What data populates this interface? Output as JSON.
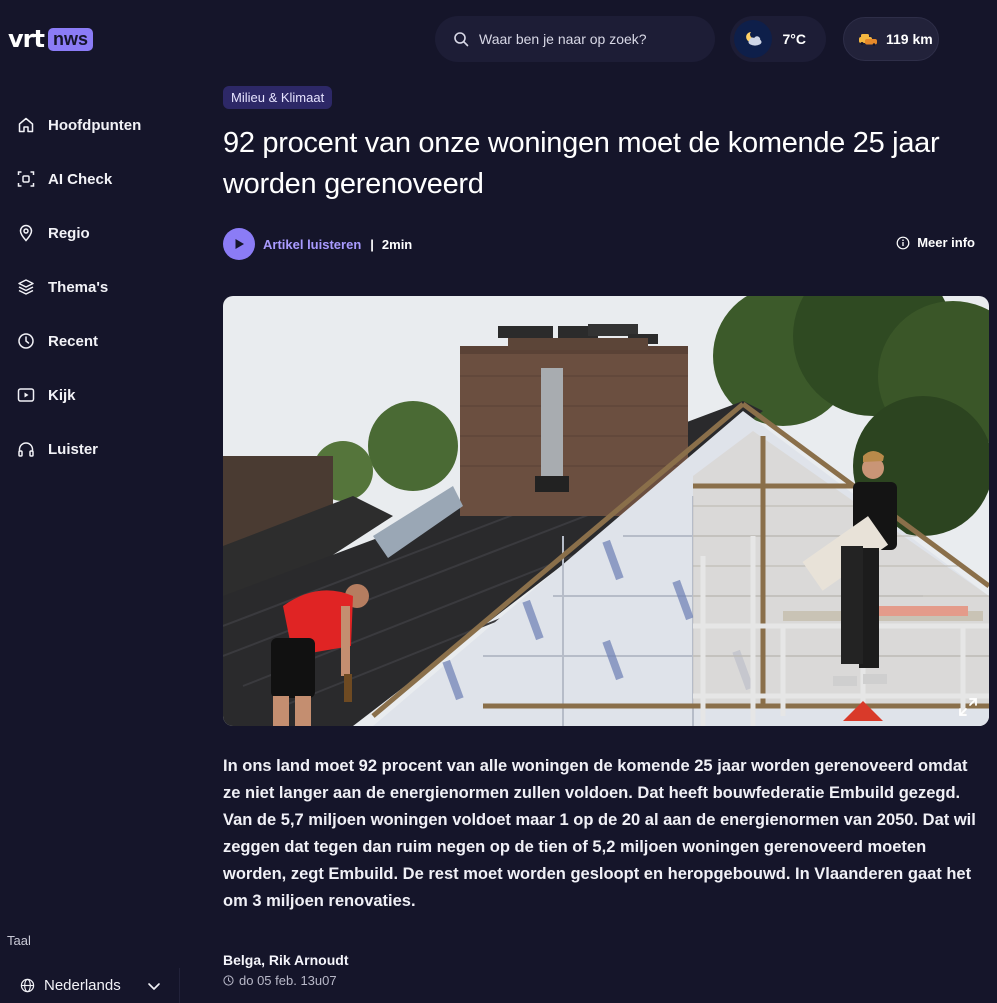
{
  "header": {
    "logo": {
      "brand": "vrt",
      "badge": "nws"
    },
    "search": {
      "placeholder": "Waar ben je naar op zoek?"
    },
    "weather": {
      "temperature": "7°C",
      "icon": "partly-cloudy-night-icon"
    },
    "traffic": {
      "distance": "119 km",
      "icon": "traffic-car-icon"
    }
  },
  "sidebar": {
    "items": [
      {
        "label": "Hoofdpunten",
        "icon": "home-icon"
      },
      {
        "label": "AI Check",
        "icon": "ai-scan-icon"
      },
      {
        "label": "Regio",
        "icon": "location-pin-icon"
      },
      {
        "label": "Thema's",
        "icon": "layers-icon"
      },
      {
        "label": "Recent",
        "icon": "clock-icon"
      },
      {
        "label": "Kijk",
        "icon": "play-screen-icon"
      },
      {
        "label": "Luister",
        "icon": "headphones-icon"
      }
    ],
    "language_label": "Taal",
    "language_value": "Nederlands"
  },
  "article": {
    "category": "Milieu & Klimaat",
    "title": "92 procent van onze woningen moet de komende 25 jaar worden gerenoveerd",
    "listen_label": "Artikel luisteren",
    "separator": "|",
    "duration": "2min",
    "more_info": "Meer info",
    "lead": "In ons land moet 92 procent van alle woningen de komende 25 jaar worden gerenoveerd omdat ze niet langer aan de energienormen zullen voldoen. Dat heeft bouwfederatie Embuild gezegd. Van de 5,7 miljoen woningen voldoet maar 1 op de 20 al aan de energienormen van 2050. Dat wil zeggen dat tegen dan ruim negen op de tien of 5,2 miljoen woningen gerenoveerd moeten worden, zegt Embuild. De rest moet worden gesloopt en heropgebouwd. In Vlaanderen gaat het om 3 miljoen renovaties.",
    "author": "Belga, Rik Arnoudt",
    "date": "do 05 feb. 13u07"
  },
  "colors": {
    "background": "#15152a",
    "accent": "#8b7cf6",
    "category_bg": "#2d2867"
  }
}
